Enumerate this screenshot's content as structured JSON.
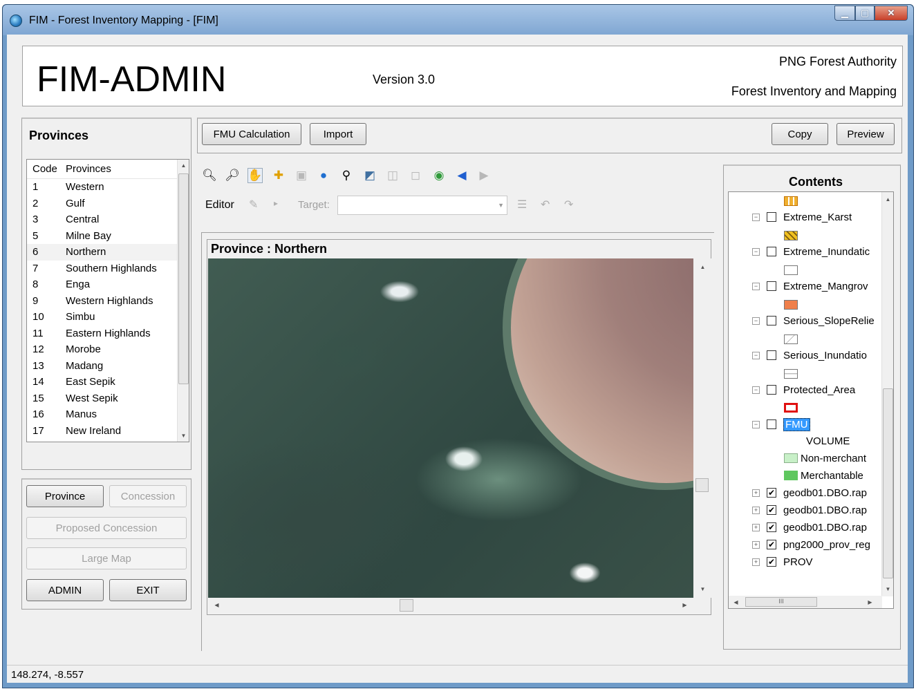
{
  "window": {
    "title": "FIM - Forest Inventory Mapping - [FIM]",
    "minimize": "▁",
    "maximize": "▢",
    "close": "✕"
  },
  "header": {
    "app_name": "FIM-ADMIN",
    "version": "Version 3.0",
    "org_line1": "PNG Forest Authority",
    "org_line2": "Forest Inventory and Mapping"
  },
  "provinces_panel": {
    "title": "Provinces",
    "columns": [
      "Code",
      "Provinces"
    ],
    "rows": [
      {
        "code": "1",
        "name": "Western"
      },
      {
        "code": "2",
        "name": "Gulf"
      },
      {
        "code": "3",
        "name": "Central"
      },
      {
        "code": "5",
        "name": "Milne Bay"
      },
      {
        "code": "6",
        "name": "Northern"
      },
      {
        "code": "7",
        "name": "Southern Highlands"
      },
      {
        "code": "8",
        "name": "Enga"
      },
      {
        "code": "9",
        "name": "Western Highlands"
      },
      {
        "code": "10",
        "name": "Simbu"
      },
      {
        "code": "11",
        "name": "Eastern Highlands"
      },
      {
        "code": "12",
        "name": "Morobe"
      },
      {
        "code": "13",
        "name": "Madang"
      },
      {
        "code": "14",
        "name": "East Sepik"
      },
      {
        "code": "15",
        "name": "West Sepik"
      },
      {
        "code": "16",
        "name": "Manus"
      },
      {
        "code": "17",
        "name": "New Ireland"
      }
    ],
    "selected_code": "6"
  },
  "left_buttons": {
    "province": "Province",
    "concession": "Concession",
    "proposed_concession": "Proposed Concession",
    "large_map": "Large Map",
    "admin": "ADMIN",
    "exit": "EXIT"
  },
  "top_buttons": {
    "fmu_calculation": "FMU Calculation",
    "import": "Import",
    "copy": "Copy",
    "preview": "Preview"
  },
  "editor_toolbar": {
    "editor_label": "Editor",
    "target_label": "Target:",
    "target_value": ""
  },
  "map": {
    "title": "Province :  Northern"
  },
  "contents": {
    "title": "Contents",
    "layers": [
      {
        "name": "Extreme_Karst",
        "checked": false
      },
      {
        "name": "Extreme_Inundatic",
        "checked": false
      },
      {
        "name": "Extreme_Mangrov",
        "checked": false
      },
      {
        "name": "Serious_SlopeRelie",
        "checked": false
      },
      {
        "name": "Serious_Inundatio",
        "checked": false
      },
      {
        "name": "Protected_Area",
        "checked": false
      },
      {
        "name": "FMU",
        "checked": false
      }
    ],
    "fmu_legend": {
      "heading": "VOLUME",
      "items": [
        "Non-merchant",
        "Merchantable"
      ]
    },
    "groups": [
      {
        "name": "geodb01.DBO.rap",
        "checked": true
      },
      {
        "name": "geodb01.DBO.rap",
        "checked": true
      },
      {
        "name": "geodb01.DBO.rap",
        "checked": true
      },
      {
        "name": "png2000_prov_reg",
        "checked": true
      },
      {
        "name": "PROV",
        "checked": true
      }
    ],
    "hscroll_grip": "III"
  },
  "status": {
    "coordinates": "148.274, -8.557"
  },
  "colors": {
    "swatch_karst": "#e8a030",
    "swatch_mangrove": "#ef7f4a",
    "swatch_non_merchant": "#c8f0c8",
    "swatch_merchantable": "#5fc75f",
    "fmu_highlight": "#3399ff"
  }
}
